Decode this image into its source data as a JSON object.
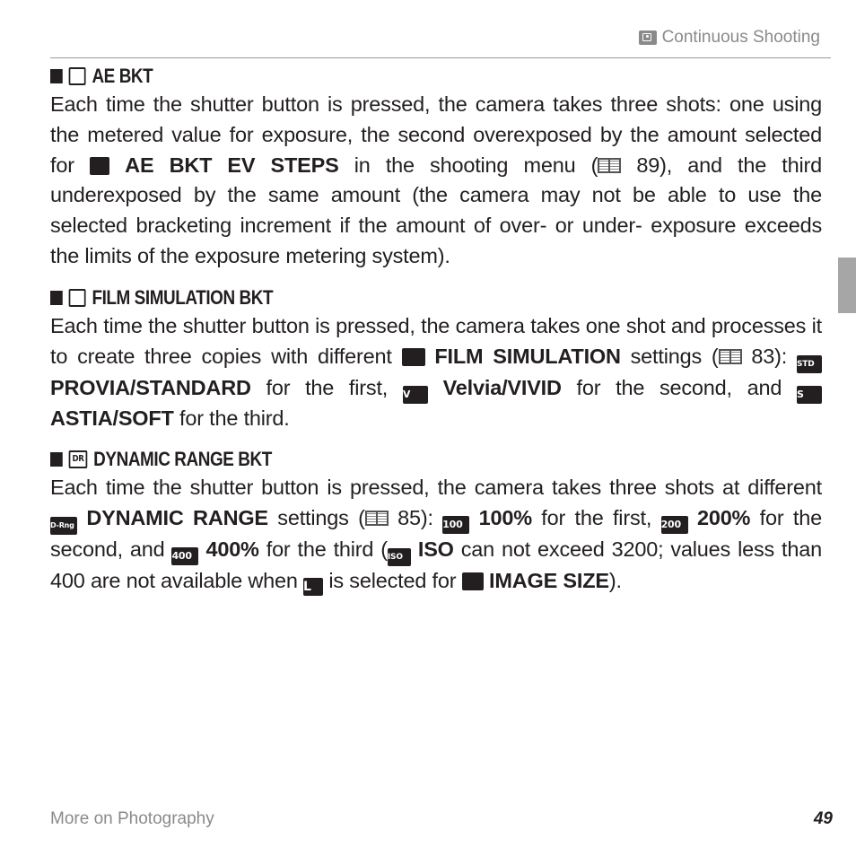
{
  "header": {
    "title": "Continuous Shooting",
    "icon": "continuous-shooting-icon"
  },
  "sections": [
    {
      "title": "AE BKT",
      "icon": "ae-bkt-icon",
      "text": {
        "p1": "Each time the shutter button is pressed, the camera takes three shots: one using the metered value for exposure, the second overexposed by the amount selected for ",
        "b1": "AE BKT EV STEPS",
        "p2": " in the shooting menu (",
        "ref": "89",
        "p3": "), and the third underexposed by the same amount (the camera may not be able to use the selected bracketing increment if the amount of over- or under- exposure exceeds the limits of the exposure metering system)."
      }
    },
    {
      "title": "FILM SIMULATION BKT",
      "icon": "film-simulation-bkt-icon",
      "text": {
        "p1": "Each time the shutter button is pressed, the camera takes one shot and processes it to create three copies with different ",
        "b1": "FILM SIMULATION",
        "p2": " settings (",
        "ref": "83",
        "p3": "): ",
        "b2": "PROVIA/STANDARD",
        "p4": " for the first, ",
        "b3": "Velvia/VIVID",
        "p5": " for the second, and ",
        "b4": "ASTIA/SOFT",
        "p6": " for the third.",
        "icon_std": "STD",
        "icon_v": "V",
        "icon_s": "S"
      }
    },
    {
      "title": "DYNAMIC RANGE BKT",
      "icon": "dynamic-range-bkt-icon",
      "icon_text": "DR",
      "text": {
        "p1": "Each time the shutter button is pressed, the camera takes three shots at different ",
        "b1": "DYNAMIC RANGE",
        "p2": " settings (",
        "ref": "85",
        "p3": "): ",
        "b2": "100%",
        "p4": " for the first, ",
        "b3": "200%",
        "p5": " for the second, and ",
        "b4": "400%",
        "p6": " for the third (",
        "b5": "ISO",
        "p7": " can not exceed 3200; values less than 400 are not available when ",
        "p8": " is selected for ",
        "b6": "IMAGE SIZE",
        "p9": ").",
        "icon_drng": "D-Rng",
        "icon_100": "100",
        "icon_200": "200",
        "icon_400": "400",
        "icon_iso": "ISO",
        "icon_l": "L"
      }
    }
  ],
  "footer": {
    "section": "More on Photography",
    "page_number": "49"
  }
}
